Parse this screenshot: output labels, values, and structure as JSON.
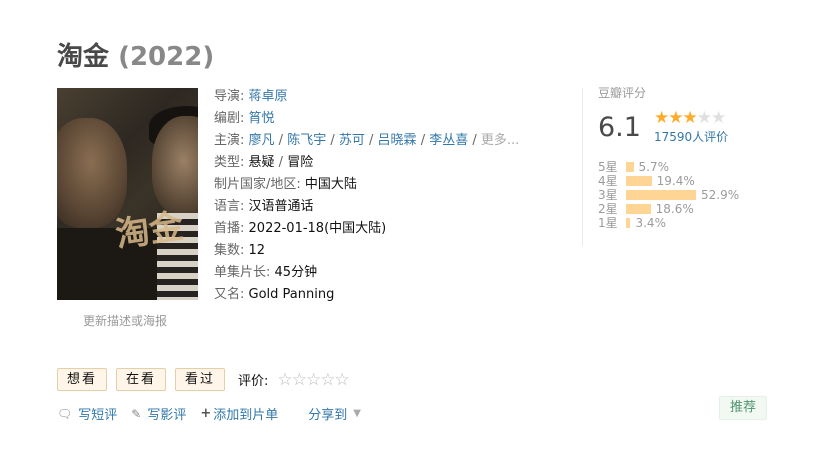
{
  "title": "淘金",
  "year": "(2022)",
  "update_link": "更新描述或海报",
  "info": {
    "director_label": "导演",
    "director": "蒋卓原",
    "writer_label": "编剧",
    "writer": "筲悦",
    "cast_label": "主演",
    "cast": [
      "廖凡",
      "陈飞宇",
      "苏可",
      "吕晓霖",
      "李丛喜"
    ],
    "cast_more": "更多...",
    "genre_label": "类型",
    "genres": [
      "悬疑",
      "冒险"
    ],
    "country_label": "制片国家/地区",
    "country": "中国大陆",
    "language_label": "语言",
    "language": "汉语普通话",
    "premiere_label": "首播",
    "premiere": "2022-01-18(中国大陆)",
    "episodes_label": "集数",
    "episodes": "12",
    "runtime_label": "单集片长",
    "runtime": "45分钟",
    "aka_label": "又名",
    "aka": "Gold Panning"
  },
  "rating": {
    "label": "豆瓣评分",
    "score": "6.1",
    "stars_filled": 3,
    "stars_total": 5,
    "votes": "17590人评价",
    "distribution": [
      {
        "label": "5星",
        "percent": 5.7,
        "text": "5.7%"
      },
      {
        "label": "4星",
        "percent": 19.4,
        "text": "19.4%"
      },
      {
        "label": "3星",
        "percent": 52.9,
        "text": "52.9%"
      },
      {
        "label": "2星",
        "percent": 18.6,
        "text": "18.6%"
      },
      {
        "label": "1星",
        "percent": 3.4,
        "text": "3.4%"
      }
    ],
    "colors": {
      "star_on": "#ffac2d",
      "bar": "#ffd596"
    }
  },
  "buttons": {
    "want": "想看",
    "watching": "在看",
    "watched": "看过",
    "eval_label": "评价:"
  },
  "actions": {
    "short_review": "写短评",
    "review": "写影评",
    "add_list": "添加到片单",
    "share": "分享到",
    "recommend": "推荐"
  },
  "icons": {
    "short_review": "speech-bubble-icon",
    "review": "pencil-icon",
    "add_list": "plus-icon",
    "share_caret": "caret-down-icon"
  }
}
